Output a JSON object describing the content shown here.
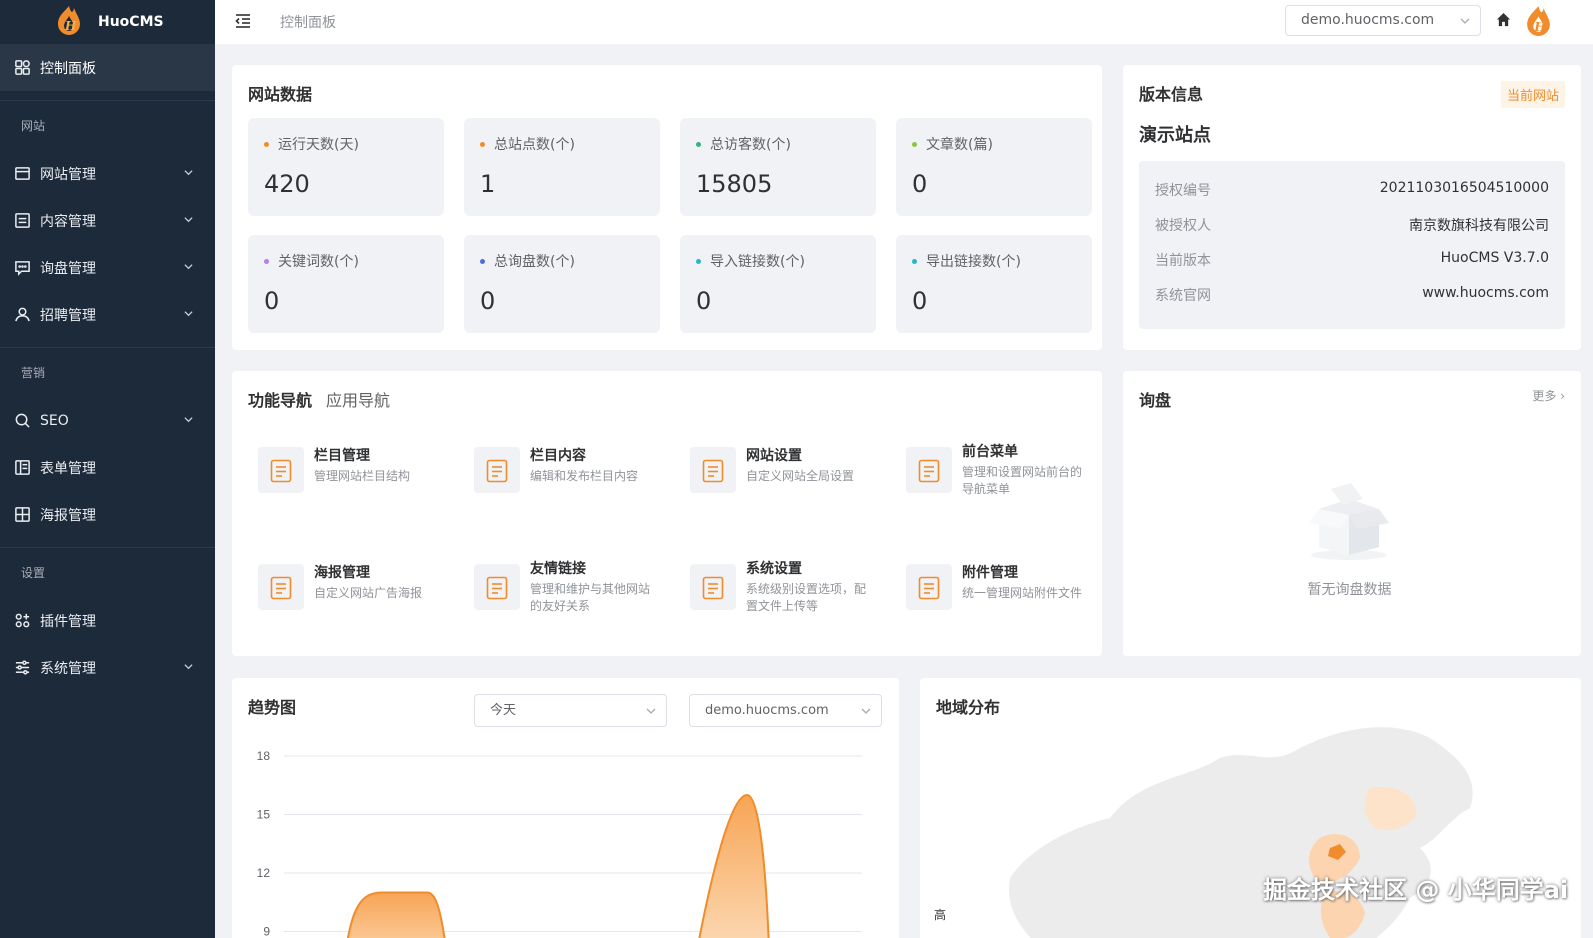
{
  "app": {
    "name": "HuoCMS",
    "brand_color": "#f08c2c",
    "sidebar_bg": "#1d2a3a"
  },
  "sidebar": {
    "active": {
      "label": "控制面板",
      "icon": "dashboard-icon"
    },
    "groups": [
      {
        "title": "网站",
        "items": [
          {
            "label": "网站管理",
            "icon": "website-icon",
            "expandable": true
          },
          {
            "label": "内容管理",
            "icon": "content-icon",
            "expandable": true
          },
          {
            "label": "询盘管理",
            "icon": "message-icon",
            "expandable": true
          },
          {
            "label": "招聘管理",
            "icon": "user-icon",
            "expandable": true
          }
        ]
      },
      {
        "title": "营销",
        "items": [
          {
            "label": "SEO",
            "icon": "search-icon",
            "expandable": true
          },
          {
            "label": "表单管理",
            "icon": "form-icon",
            "expandable": false
          },
          {
            "label": "海报管理",
            "icon": "grid-icon",
            "expandable": false
          }
        ]
      },
      {
        "title": "设置",
        "items": [
          {
            "label": "插件管理",
            "icon": "plugin-icon",
            "expandable": false
          },
          {
            "label": "系统管理",
            "icon": "sliders-icon",
            "expandable": true
          }
        ]
      }
    ]
  },
  "topbar": {
    "breadcrumb": "控制面板",
    "site_select": "demo.huocms.com"
  },
  "site_data": {
    "title": "网站数据",
    "stats": [
      {
        "label": "运行天数(天)",
        "value": "420",
        "color": "#f08c2c"
      },
      {
        "label": "总站点数(个)",
        "value": "1",
        "color": "#f08c2c"
      },
      {
        "label": "总访客数(个)",
        "value": "15805",
        "color": "#34b27b"
      },
      {
        "label": "文章数(篇)",
        "value": "0",
        "color": "#8cc63f"
      },
      {
        "label": "关键词数(个)",
        "value": "0",
        "color": "#b37feb"
      },
      {
        "label": "总询盘数(个)",
        "value": "0",
        "color": "#4a6ee0"
      },
      {
        "label": "导入链接数(个)",
        "value": "0",
        "color": "#26b5c9"
      },
      {
        "label": "导出链接数(个)",
        "value": "0",
        "color": "#26b5c9"
      }
    ]
  },
  "version": {
    "title": "版本信息",
    "badge": "当前网站",
    "site_name": "演示站点",
    "rows": [
      {
        "key": "授权编号",
        "value": "2021103016504510000"
      },
      {
        "key": "被授权人",
        "value": "南京数旗科技有限公司"
      },
      {
        "key": "当前版本",
        "value": "HuoCMS V3.7.0"
      },
      {
        "key": "系统官网",
        "value": "www.huocms.com"
      }
    ]
  },
  "function_nav": {
    "tabs": [
      "功能导航",
      "应用导航"
    ],
    "items": [
      {
        "title": "栏目管理",
        "desc": "管理网站栏目结构"
      },
      {
        "title": "栏目内容",
        "desc": "编辑和发布栏目内容"
      },
      {
        "title": "网站设置",
        "desc": "自定义网站全局设置"
      },
      {
        "title": "前台菜单",
        "desc": "管理和设置网站前台的导航菜单"
      },
      {
        "title": "海报管理",
        "desc": "自定义网站广告海报"
      },
      {
        "title": "友情链接",
        "desc": "管理和维护与其他网站的友好关系"
      },
      {
        "title": "系统设置",
        "desc": "系统级别设置选项，配置文件上传等"
      },
      {
        "title": "附件管理",
        "desc": "统一管理网站附件文件"
      }
    ]
  },
  "inquiry": {
    "title": "询盘",
    "more": "更多",
    "empty_text": "暂无询盘数据"
  },
  "trend": {
    "title": "趋势图",
    "date_select": "今天",
    "site_select": "demo.huocms.com"
  },
  "chart_data": {
    "type": "area",
    "y_ticks": [
      "18",
      "15",
      "12",
      "9"
    ],
    "ylim": [
      9,
      18
    ],
    "series_color": "#f5a55a",
    "visible_peaks": [
      {
        "label": "plateau",
        "y": 11
      },
      {
        "label": "peak",
        "y": 16
      }
    ]
  },
  "region": {
    "title": "地域分布",
    "legend_high": "高"
  },
  "watermark": "掘金技术社区 @ 小华同学ai"
}
